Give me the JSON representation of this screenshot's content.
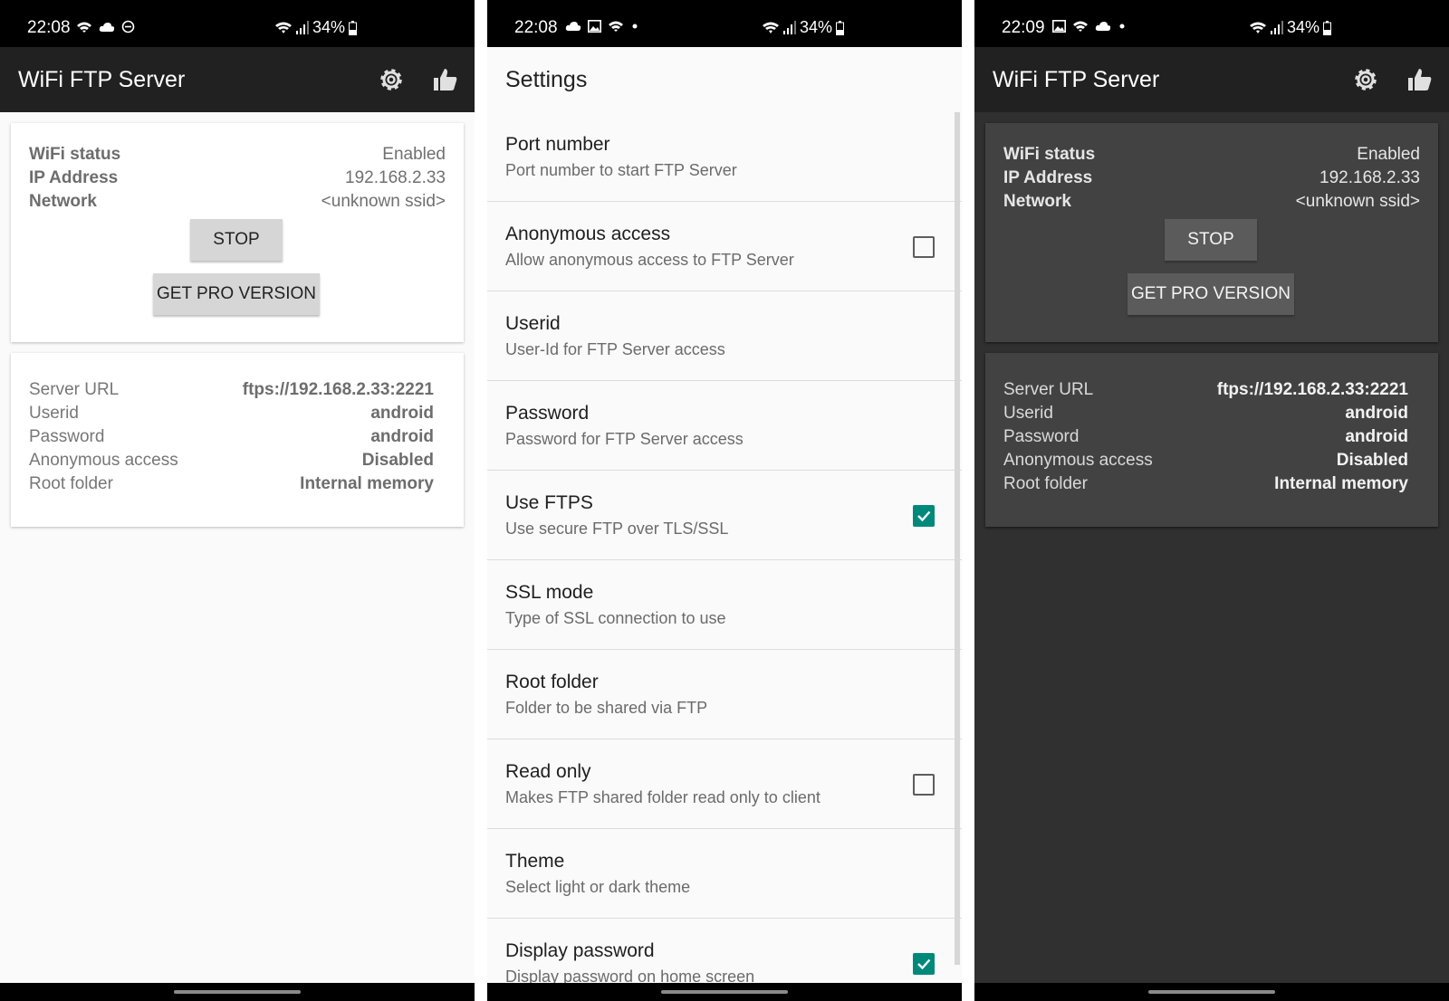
{
  "phone1": {
    "status_bar": {
      "time": "22:08",
      "battery": "34%",
      "icons": [
        "wifi-icon",
        "cloud-icon",
        "dnd-icon"
      ]
    },
    "app_title": "WiFi FTP Server",
    "status_card": {
      "rows": [
        {
          "label": "WiFi status",
          "value": "Enabled"
        },
        {
          "label": "IP Address",
          "value": "192.168.2.33"
        },
        {
          "label": "Network",
          "value": "<unknown ssid>"
        }
      ],
      "stop_label": "STOP",
      "pro_label": "GET PRO VERSION"
    },
    "info_card": {
      "rows": [
        {
          "label": "Server URL",
          "value": "ftps://192.168.2.33:2221"
        },
        {
          "label": "Userid",
          "value": "android"
        },
        {
          "label": "Password",
          "value": "android"
        },
        {
          "label": "Anonymous access",
          "value": "Disabled"
        },
        {
          "label": "Root folder",
          "value": "Internal memory"
        }
      ]
    }
  },
  "phone2": {
    "status_bar": {
      "time": "22:08",
      "battery": "34%",
      "icons": [
        "cloud-icon",
        "image-icon",
        "wifi-icon",
        "dot-icon"
      ]
    },
    "title": "Settings",
    "items": [
      {
        "title": "Port number",
        "subtitle": "Port number to start FTP Server",
        "checkbox": null
      },
      {
        "title": "Anonymous access",
        "subtitle": "Allow anonymous access to FTP Server",
        "checkbox": false
      },
      {
        "title": "Userid",
        "subtitle": "User-Id for FTP Server access",
        "checkbox": null
      },
      {
        "title": "Password",
        "subtitle": "Password for FTP Server access",
        "checkbox": null
      },
      {
        "title": "Use FTPS",
        "subtitle": "Use secure FTP over TLS/SSL",
        "checkbox": true
      },
      {
        "title": "SSL mode",
        "subtitle": "Type of SSL connection to use",
        "checkbox": null
      },
      {
        "title": "Root folder",
        "subtitle": "Folder to be shared via FTP",
        "checkbox": null
      },
      {
        "title": "Read only",
        "subtitle": "Makes FTP shared folder read only to client",
        "checkbox": false
      },
      {
        "title": "Theme",
        "subtitle": "Select light or dark theme",
        "checkbox": null
      },
      {
        "title": "Display password",
        "subtitle": "Display password on home screen",
        "checkbox": true
      }
    ],
    "accent_color": "#00897b"
  },
  "phone3": {
    "status_bar": {
      "time": "22:09",
      "battery": "34%",
      "icons": [
        "image-icon",
        "wifi-icon",
        "cloud-icon",
        "dot-icon"
      ]
    },
    "app_title": "WiFi FTP Server",
    "status_card": {
      "rows": [
        {
          "label": "WiFi status",
          "value": "Enabled"
        },
        {
          "label": "IP Address",
          "value": "192.168.2.33"
        },
        {
          "label": "Network",
          "value": "<unknown ssid>"
        }
      ],
      "stop_label": "STOP",
      "pro_label": "GET PRO VERSION"
    },
    "info_card": {
      "rows": [
        {
          "label": "Server URL",
          "value": "ftps://192.168.2.33:2221"
        },
        {
          "label": "Userid",
          "value": "android"
        },
        {
          "label": "Password",
          "value": "android"
        },
        {
          "label": "Anonymous access",
          "value": "Disabled"
        },
        {
          "label": "Root folder",
          "value": "Internal memory"
        }
      ]
    }
  }
}
